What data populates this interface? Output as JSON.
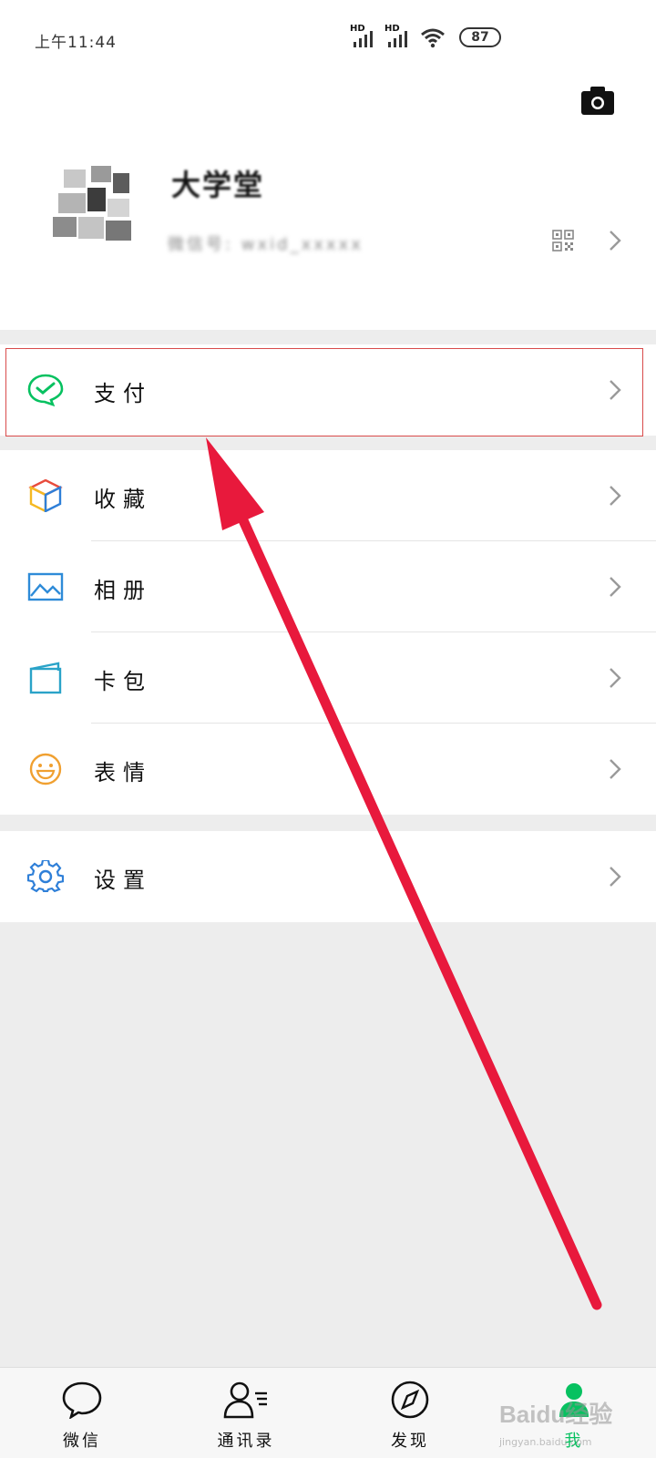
{
  "status_bar": {
    "time": "上午11:44",
    "signal_label": "HD",
    "battery": "87"
  },
  "profile": {
    "nickname": "大学堂",
    "wechat_id": "微信号: wxid_xxxxx"
  },
  "menu": {
    "pay": "支付",
    "favorites": "收藏",
    "album": "相册",
    "cards": "卡包",
    "stickers": "表情",
    "settings": "设置"
  },
  "tabbar": {
    "chats": "微信",
    "contacts": "通讯录",
    "discover": "发现",
    "me": "我"
  },
  "watermark": {
    "text": "Baidu经验",
    "url": "jingyan.baidu.com"
  },
  "colors": {
    "accent_green": "#07c160",
    "annotation_red": "#e8193c",
    "highlight_border": "#d94b4b"
  }
}
